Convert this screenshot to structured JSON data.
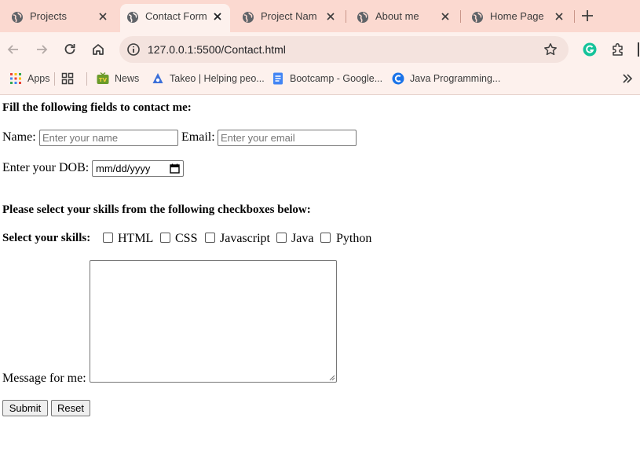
{
  "tabs": [
    {
      "title": "Projects",
      "active": false
    },
    {
      "title": "Contact Form",
      "active": true
    },
    {
      "title": "Project Name",
      "active": false
    },
    {
      "title": "About me",
      "active": false
    },
    {
      "title": "Home Page",
      "active": false
    }
  ],
  "toolbar": {
    "url": "127.0.0.1:5500/Contact.html"
  },
  "bookmarks": [
    {
      "label": "Apps",
      "icon": "apps-grid-icon"
    },
    {
      "label": "",
      "icon": "tab-groups-icon"
    },
    {
      "label": "News",
      "icon": "news-tv-icon"
    },
    {
      "label": "Takeo | Helping peo...",
      "icon": "takeo-icon"
    },
    {
      "label": "Bootcamp - Google...",
      "icon": "google-docs-icon"
    },
    {
      "label": "Java Programming...",
      "icon": "c-logo-icon"
    }
  ],
  "form": {
    "heading": "Fill the following fields to contact me:",
    "name_label": "Name:",
    "name_placeholder": "Enter your name",
    "email_label": "Email:",
    "email_placeholder": "Enter your email",
    "dob_label": "Enter your DOB:",
    "dob_placeholder": "mm/dd/yyyy",
    "skills_heading": "Please select your skills from the following checkboxes below:",
    "skills_label": "Select your skills:",
    "skills": [
      "HTML",
      "CSS",
      "Javascript",
      "Java",
      "Python"
    ],
    "message_label": "Message for me:",
    "submit_label": "Submit",
    "reset_label": "Reset"
  },
  "colors": {
    "tabstrip": "#fbd9d0",
    "toolbar": "#fdf1ed",
    "grammarly": "#15c39a"
  }
}
